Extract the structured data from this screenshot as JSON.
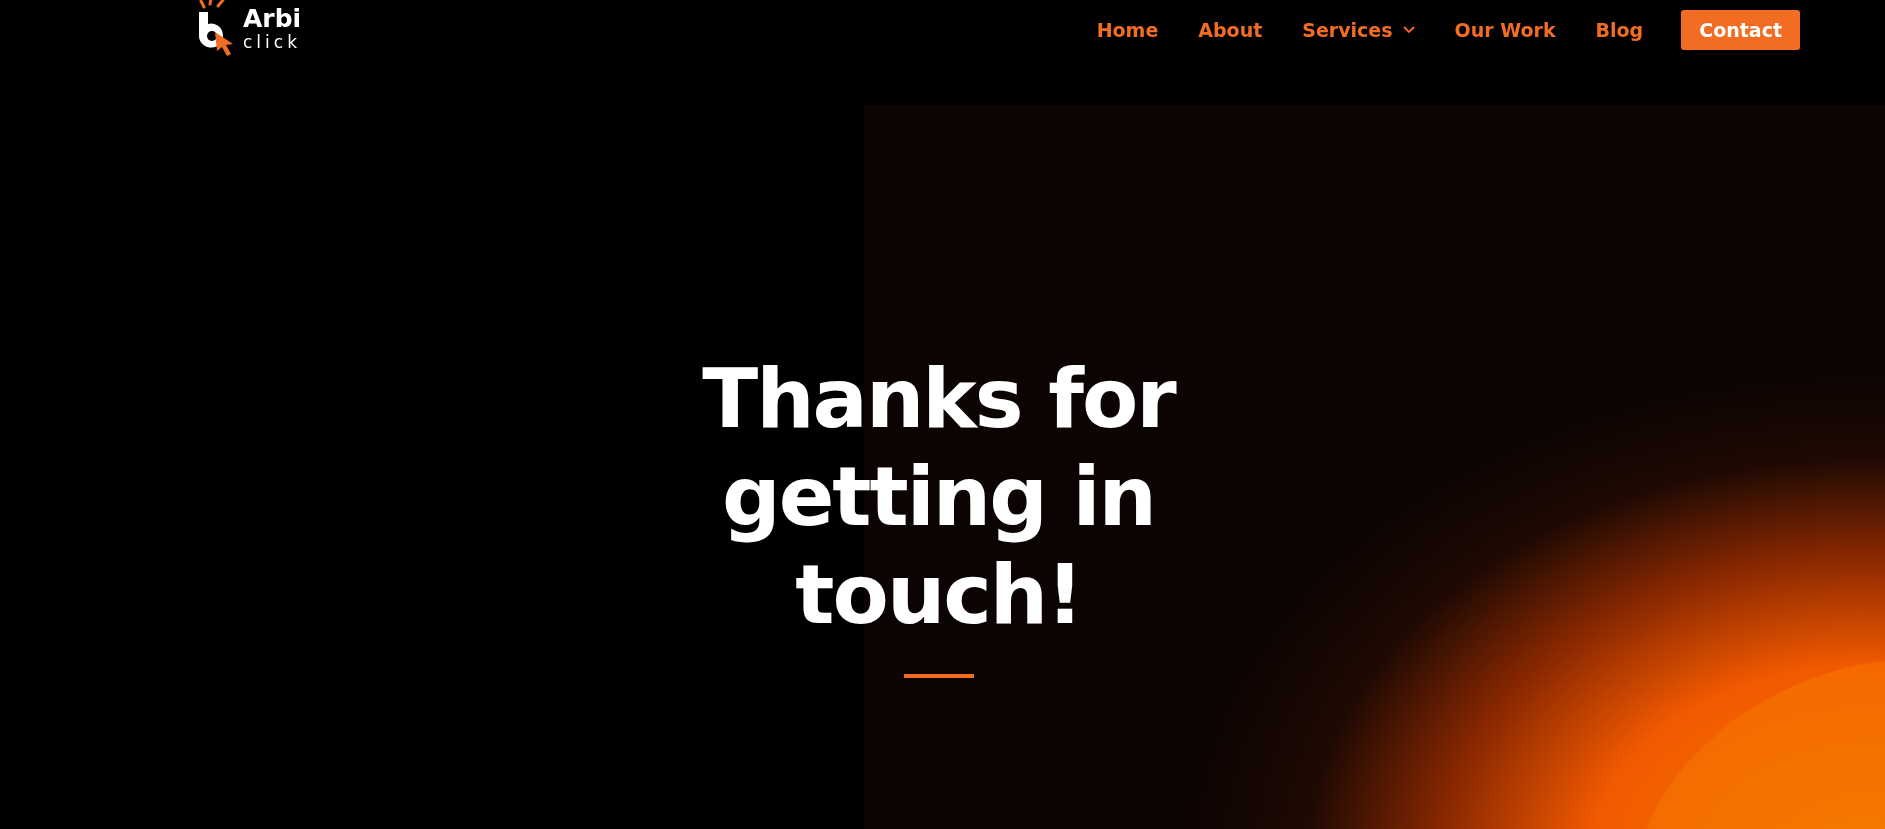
{
  "logo": {
    "name": "Arbi",
    "sub": "click"
  },
  "nav": [
    {
      "label": "Home",
      "dropdown": false
    },
    {
      "label": "About",
      "dropdown": false
    },
    {
      "label": "Services",
      "dropdown": true
    },
    {
      "label": "Our Work",
      "dropdown": false
    },
    {
      "label": "Blog",
      "dropdown": false
    }
  ],
  "cta": "Contact",
  "hero": {
    "lines": [
      "Thanks for",
      "getting in",
      "touch!"
    ]
  }
}
